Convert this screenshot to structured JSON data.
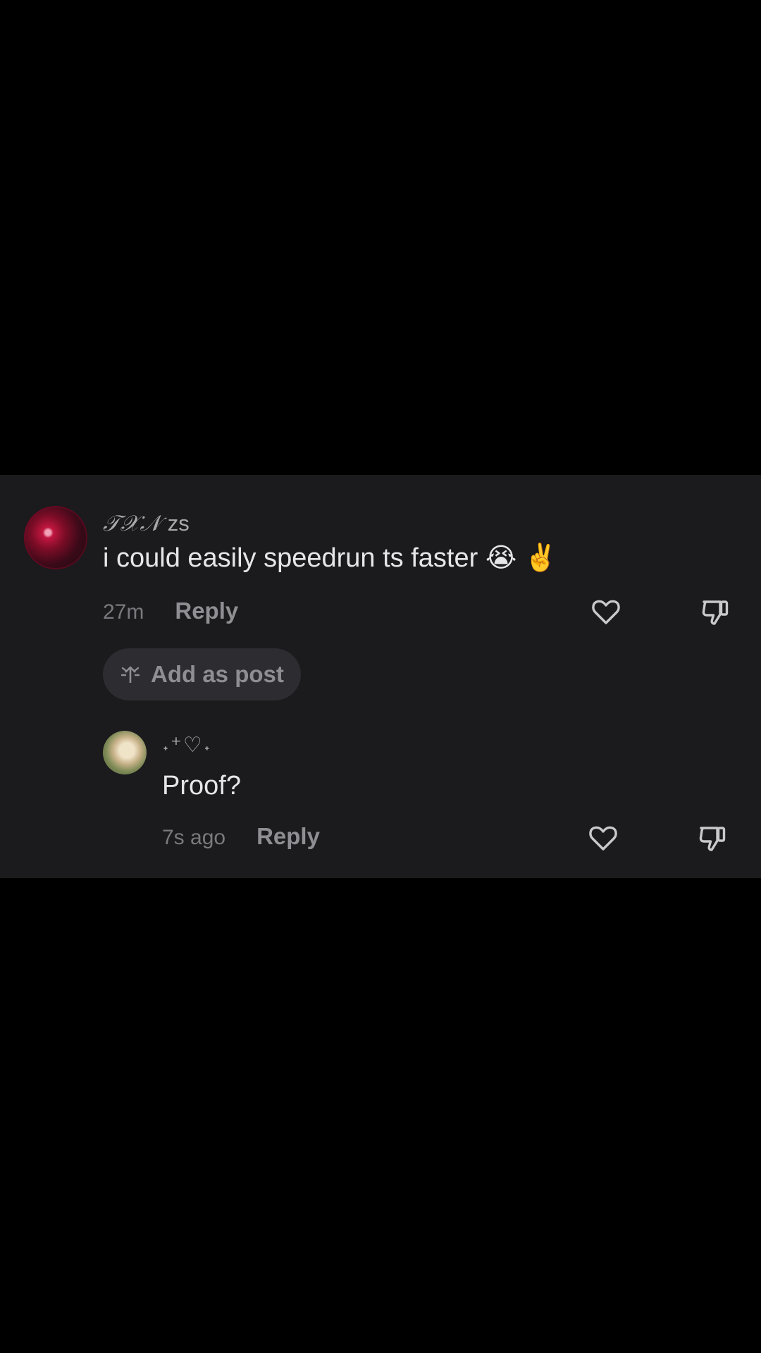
{
  "comments": [
    {
      "username_script": "𝒯𝒳𝒩",
      "username_rest": " zs",
      "text": "i could easily speedrun ts faster 😭 ✌️",
      "time": "27m",
      "reply_label": "Reply",
      "add_as_post_label": "Add as post"
    }
  ],
  "replies": [
    {
      "username": "˖⁺♡˖",
      "text": "Proof?",
      "time": "7s ago",
      "reply_label": "Reply"
    }
  ],
  "colors": {
    "panel_background": "#1b1a1d",
    "page_background": "#000000",
    "primary_text": "#e6e6e8",
    "secondary_text": "#8e8e93",
    "pill_background": "#2d2c30"
  },
  "icons": {
    "like": "heart-outline-icon",
    "dislike": "thumbs-down-icon",
    "add_post": "sparkle-arrow-icon"
  }
}
